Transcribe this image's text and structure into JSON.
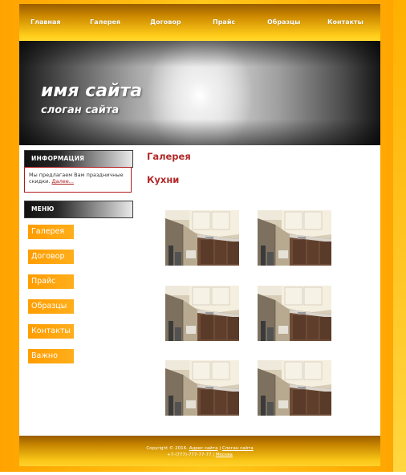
{
  "nav": {
    "items": [
      "Главная",
      "Галерея",
      "Договор",
      "Прайс",
      "Образцы",
      "Контакты"
    ]
  },
  "banner": {
    "site_name": "имя сайта",
    "slogan": "слоган сайта"
  },
  "sidebar": {
    "info_title": "ИНФОРМАЦИЯ",
    "info_text": "Мы предлагаем Вам праздничные скидки.",
    "info_link": "Далее...",
    "menu_title": "МЕНЮ",
    "menu_items": [
      "Галерея",
      "Договор",
      "Прайс",
      "Образцы",
      "Контакты",
      "Важно"
    ]
  },
  "main": {
    "title": "Галерея",
    "subtitle": "Кухни",
    "gallery": [
      {
        "icon": "kitchen-photo"
      },
      {
        "icon": "kitchen-photo"
      },
      {
        "icon": "kitchen-photo"
      },
      {
        "icon": "kitchen-photo"
      },
      {
        "icon": "kitchen-photo"
      },
      {
        "icon": "kitchen-photo"
      }
    ]
  },
  "footer": {
    "copyright": "Copyright © 2016.",
    "site_address_link": "Адрес сайта",
    "separator": "|",
    "site_slogan_link": "Слоган сайта",
    "phone": "+7-(777)-777-77-77",
    "city_link": "Москва"
  },
  "colors": {
    "frame": "#ffb300",
    "accent_red": "#b22a2a",
    "menu_button": "#ffa000"
  }
}
